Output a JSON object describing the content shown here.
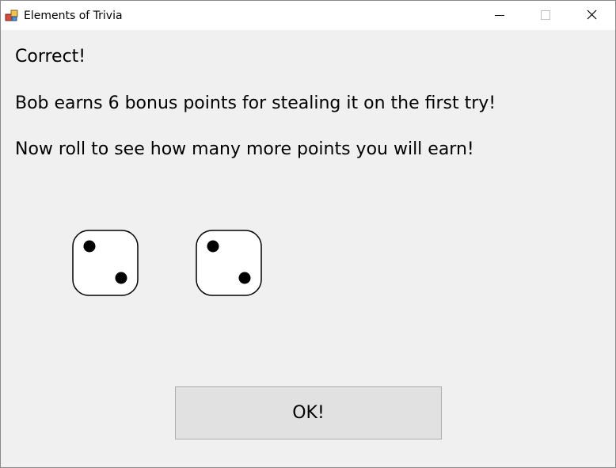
{
  "window": {
    "title": "Elements of Trivia"
  },
  "message": {
    "line1": "Correct!",
    "line2": "Bob earns 6 bonus points for stealing it on the first try!",
    "line3": "Now roll to see how many more points you will earn!"
  },
  "dice": [
    {
      "value": 2
    },
    {
      "value": 2
    }
  ],
  "buttons": {
    "ok_label": "OK!"
  }
}
